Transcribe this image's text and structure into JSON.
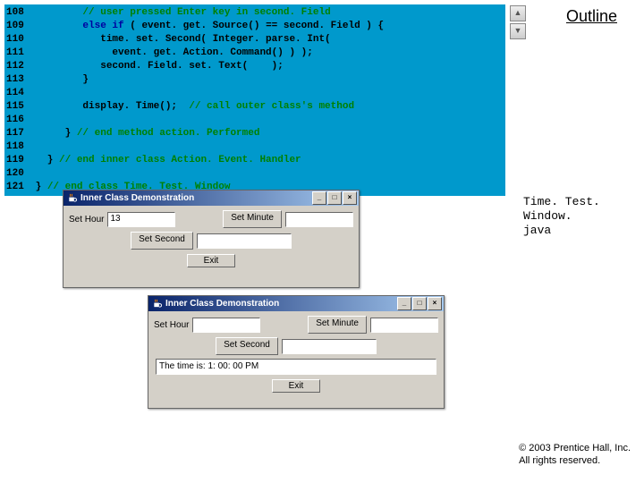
{
  "outline": "Outline",
  "filename_l1": "Time. Test. Window.",
  "filename_l2": "java",
  "copyright_l1": "© 2003 Prentice Hall, Inc.",
  "copyright_l2": "All rights reserved.",
  "code": {
    "l108_n": "108",
    "l108_a": "         ",
    "l108_b": "// user pressed Enter key in second. Field",
    "l109_n": "109",
    "l109_a": "         ",
    "l109_b": "else if",
    "l109_c": " ( event. get. Source() == second. Field ) {",
    "l110_n": "110",
    "l110_a": "            time. set. Second( Integer. parse. Int(",
    "l111_n": "111",
    "l111_a": "              event. get. Action. Command() ) );",
    "l112_n": "112",
    "l112_a": "            second. Field. set. Text(    );",
    "l113_n": "113",
    "l113_a": "         }",
    "l114_n": "114",
    "l114_a": " ",
    "l115_n": "115",
    "l115_a": "         display. Time();  ",
    "l115_b": "// call outer class's method",
    "l116_n": "116",
    "l116_a": " ",
    "l117_n": "117",
    "l117_a": "      } ",
    "l117_b": "// end method action. Performed",
    "l118_n": "118",
    "l118_a": " ",
    "l119_n": "119",
    "l119_a": "   } ",
    "l119_b": "// end inner class Action. Event. Handler",
    "l120_n": "120",
    "l120_a": " ",
    "l121_n": "121",
    "l121_a": " } ",
    "l121_b": "// end class Time. Test. Window"
  },
  "win": {
    "title": "Inner Class Demonstration",
    "set_hour": "Set Hour",
    "hour_val": "13",
    "set_minute": "Set Minute",
    "set_second": "Set Second",
    "exit": "Exit",
    "time_text": "The time is: 1: 00: 00 PM",
    "min_btn": "_",
    "max_btn": "□",
    "close_btn": "×",
    "up": "▲",
    "down": "▼"
  }
}
